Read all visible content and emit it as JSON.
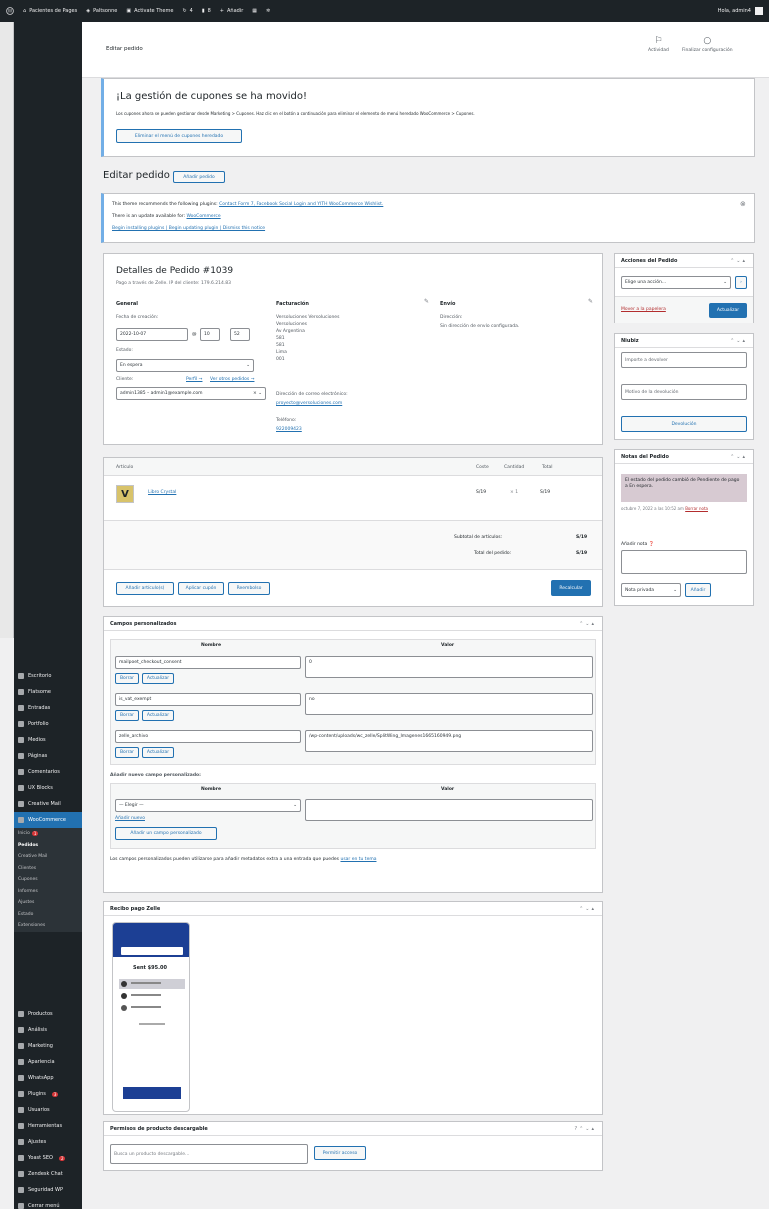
{
  "admin_bar": {
    "wp_logo": "wordpress-icon",
    "site_name": "Pacientes de Pages",
    "updates": "Paltsonne",
    "theme": "Activate Theme",
    "comments": "8",
    "new": "Añadir",
    "extra": "",
    "greeting": "Hola, admin4"
  },
  "sidebar": {
    "top_items": [
      {
        "label": "Escritorio",
        "icon": "dashboard-icon"
      },
      {
        "label": "Flatsome",
        "icon": "flatsome-icon"
      },
      {
        "label": "Entradas",
        "icon": "pin-icon"
      },
      {
        "label": "Portfolio",
        "icon": "portfolio-icon"
      },
      {
        "label": "Medios",
        "icon": "media-icon"
      },
      {
        "label": "Páginas",
        "icon": "pages-icon"
      },
      {
        "label": "Comentarios",
        "icon": "comments-icon"
      },
      {
        "label": "UX Blocks",
        "icon": "blocks-icon"
      },
      {
        "label": "Creative Mail",
        "icon": "mail-icon"
      }
    ],
    "woocommerce": {
      "label": "WooCommerce",
      "icon": "woocommerce-icon"
    },
    "woo_sub": [
      {
        "label": "Inicio",
        "badge": "1"
      },
      {
        "label": "Pedidos",
        "current": true
      },
      {
        "label": "Creative Mail"
      },
      {
        "label": "Clientes"
      },
      {
        "label": "Cupones"
      },
      {
        "label": "Informes"
      },
      {
        "label": "Ajustes"
      },
      {
        "label": "Estado"
      },
      {
        "label": "Extensiones"
      }
    ],
    "bottom_items": [
      {
        "label": "Productos",
        "icon": "products-icon"
      },
      {
        "label": "Análisis",
        "icon": "analytics-icon"
      },
      {
        "label": "Marketing",
        "icon": "megaphone-icon"
      },
      {
        "label": "Apariencia",
        "icon": "brush-icon"
      },
      {
        "label": "WhatsApp",
        "icon": "whatsapp-icon"
      },
      {
        "label": "Plugins",
        "icon": "plugin-icon",
        "badge": "3"
      },
      {
        "label": "Usuarios",
        "icon": "users-icon"
      },
      {
        "label": "Herramientas",
        "icon": "tools-icon"
      },
      {
        "label": "Ajustes",
        "icon": "settings-icon"
      },
      {
        "label": "Yoast SEO",
        "icon": "yoast-icon",
        "badge": "2"
      },
      {
        "label": "Zendesk Chat",
        "icon": "chat-icon"
      },
      {
        "label": "Seguridad WP",
        "icon": "shield-icon"
      },
      {
        "label": "Cerrar menú",
        "icon": "collapse-icon"
      }
    ]
  },
  "topbar": {
    "title": "Editar pedido",
    "activity": "Actividad",
    "finish_setup": "Finalizar configuración"
  },
  "coupon_notice": {
    "title": "¡La gestión de cupones se ha movido!",
    "text": "Los cupones ahora se pueden gestionar desde Marketing > Cupones. Haz clic en el botón a continuación para eliminar el elemento de menú heredado WooCommerce > Cupones.",
    "button": "Eliminar el menú de cupones heredado"
  },
  "page": {
    "heading": "Editar pedido",
    "add_button": "Añadir pedido"
  },
  "plugin_notice": {
    "line1_prefix": "This theme recommends the following plugins:",
    "line1_links": "Contact Form 7, Facebook Social Login and YITH WooCommerce Wishlist.",
    "line2_prefix": "There is an update available for:",
    "line2_link": "WooCommerce",
    "line3": "Begin installing plugins | Begin updating plugin | Dismiss this notice"
  },
  "order": {
    "title": "Detalles de Pedido #1039",
    "subtitle": "Pago a través de Zelle. IP del cliente: 179.6.214.83",
    "general": {
      "heading": "General",
      "date_label": "Fecha de creación:",
      "date": "2022-10-07",
      "hour": "10",
      "minute": "52",
      "at": "@",
      "status_label": "Estado:",
      "status": "En espera",
      "client_label": "Cliente:",
      "profile_link": "Perfil →",
      "other_orders_link": "Ver otros pedidos →",
      "client": "admin1385 – admin1@example.com"
    },
    "billing": {
      "heading": "Facturación",
      "lines": [
        "Versoluciones Versoluciones",
        "Versoluciones",
        "Av Argentina",
        "581",
        "581",
        "Lima",
        "001"
      ],
      "email_label": "Dirección de correo electrónico:",
      "email": "proyecto@versoluciones.com",
      "phone_label": "Teléfono:",
      "phone": "922009423"
    },
    "shipping": {
      "heading": "Envío",
      "address_label": "Dirección:",
      "address": "Sin dirección de envío configurada."
    }
  },
  "items": {
    "col_item": "Artículo",
    "col_cost": "Coste",
    "col_qty": "Cantidad",
    "col_total": "Total",
    "product_name": "Libro Crystal",
    "cost": "S/19",
    "qty": "× 1",
    "total": "S/19",
    "subtotal_label": "Subtotal de artículos:",
    "subtotal": "S/19",
    "order_total_label": "Total del pedido:",
    "order_total": "S/19",
    "btn_add": "Añadir artículo(s)",
    "btn_coupon": "Aplicar cupón",
    "btn_refund": "Reembolso",
    "btn_recalc": "Recalcular"
  },
  "custom_fields": {
    "title": "Campos personalizados",
    "col_name": "Nombre",
    "col_value": "Valor",
    "rows": [
      {
        "name": "mailpoet_checkout_consent",
        "value": "0"
      },
      {
        "name": "is_vat_exempt",
        "value": "no"
      },
      {
        "name": "zelle_archivo",
        "value": "/wp-content/uploads/wc_zelle/SplitWing_Imagenes1665160949.png"
      }
    ],
    "btn_delete": "Borrar",
    "btn_update": "Actualizar",
    "add_new_label": "Añadir nuevo campo personalizado:",
    "select_placeholder": "— Elegir —",
    "add_new_link": "Añadir nuevo",
    "add_button": "Añadir un campo personalizado",
    "footer_text_prefix": "Los campos personalizados pueden utilizarse para añadir metadatos extra a una entrada que puedes",
    "footer_link": "usar en tu tema"
  },
  "receipt": {
    "title": "Recibo pago Zelle",
    "amount": "Sent $95.00"
  },
  "downloads": {
    "title": "Permisos de producto descargable",
    "placeholder": "Busca un producto descargable…",
    "button": "Permitir acceso"
  },
  "actions_box": {
    "title": "Acciones del Pedido",
    "select": "Elige una acción...",
    "trash_link": "Mover a la papelera",
    "update": "Actualizar"
  },
  "refund_box": {
    "title": "Niubiz",
    "amount_placeholder": "Importe a devolver",
    "reason_placeholder": "Motivo de la devolución",
    "button": "Devolución"
  },
  "notes_box": {
    "title": "Notas del Pedido",
    "note": "El estado del pedido cambió de Pendiente de pago a En espera.",
    "meta_prefix": "octubre 7, 2022 a las 10:52 am",
    "delete_link": "Borrar nota",
    "add_label": "Añadir nota",
    "type": "Nota privada",
    "add_button": "Añadir"
  }
}
